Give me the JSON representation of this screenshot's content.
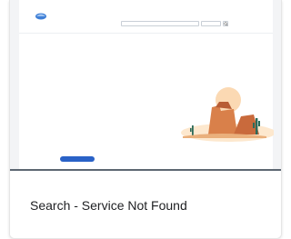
{
  "caption": "Search - Service Not Found",
  "colors": {
    "accent": "#2a62c7",
    "link": "#4a7bd4",
    "divider": "#5d6772",
    "illustration_sky": "#fde5c9",
    "illustration_rock": "#d9804a"
  }
}
